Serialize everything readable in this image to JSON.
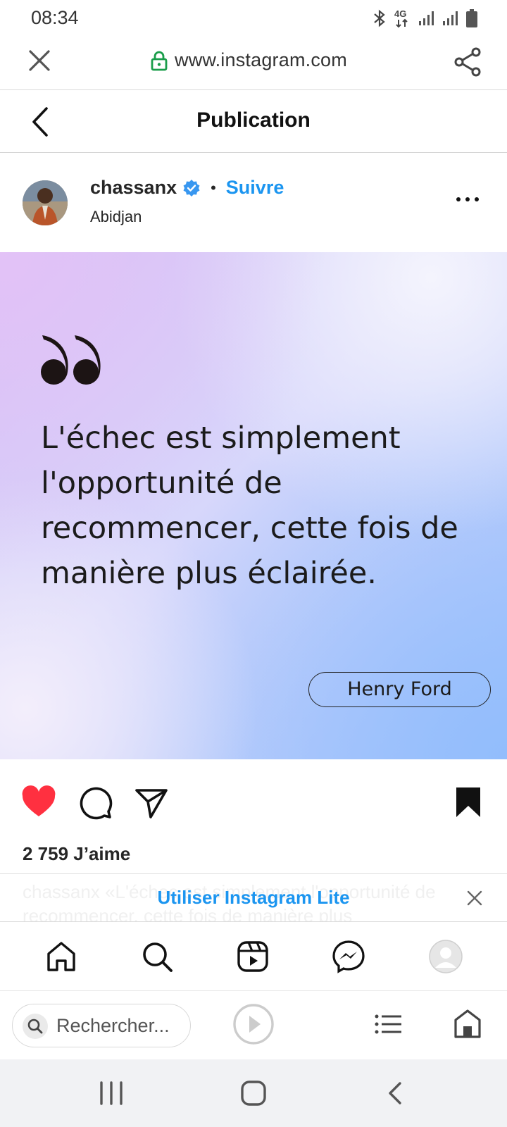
{
  "status_bar": {
    "time": "08:34",
    "network": "4G"
  },
  "browser": {
    "url": "www.instagram.com",
    "search_placeholder": "Rechercher..."
  },
  "header": {
    "title": "Publication"
  },
  "post": {
    "username": "chassanx",
    "follow_label": "Suivre",
    "location": "Abidjan",
    "quote": "L'échec est simplement l'opportunité de recommencer, cette fois de manière plus éclairée.",
    "quote_author": "Henry Ford",
    "likes": "2 759 J’aime",
    "caption_partial": "chassanx «L'échec est simplement l'opportunité de recommencer, cette fois de manière plus"
  },
  "banner": {
    "link": "Utiliser Instagram Lite"
  },
  "colors": {
    "accent_blue": "#1b95f0",
    "like_red": "#ff3040",
    "verified_blue": "#3897f0"
  }
}
